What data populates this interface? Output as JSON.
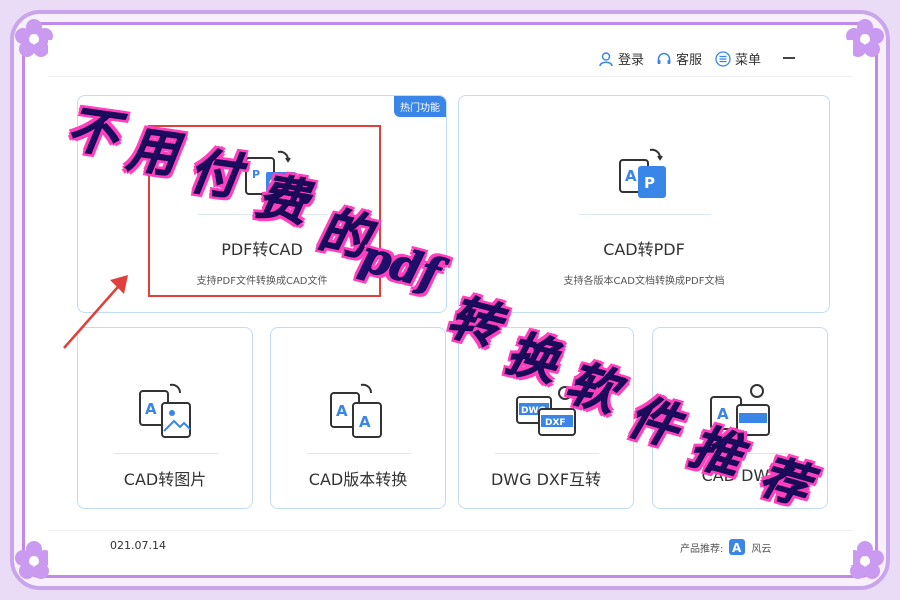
{
  "topbar": {
    "login_label": "登录",
    "service_label": "客服",
    "menu_label": "菜单"
  },
  "cards": {
    "pdf_to_cad": {
      "title": "PDF转CAD",
      "desc": "支持PDF文件转换成CAD文件",
      "badge": "热门功能"
    },
    "cad_to_pdf": {
      "title": "CAD转PDF",
      "desc": "支持各版本CAD文档转换成PDF文档"
    },
    "cad_to_image": {
      "title": "CAD转图片"
    },
    "cad_version": {
      "title": "CAD版本转换"
    },
    "dwg_dxf": {
      "title": "DWG DXF互转"
    },
    "cad_dwf": {
      "title": "CAD DWF"
    }
  },
  "footer": {
    "date": "021.07.14",
    "recommend_label": "产品推荐:",
    "product_name": "风云"
  },
  "overlay": {
    "title_chars": [
      "不",
      "用",
      "付",
      "费",
      "的",
      "pdf",
      "转",
      "换",
      "软",
      "件",
      "推",
      "荐"
    ]
  },
  "colors": {
    "accent_blue": "#3a86e8",
    "card_border": "#c3dcf5",
    "frame_purple": "#c08be8",
    "overlay_pink": "#ff3fbf",
    "overlay_navy": "#1d0f6b",
    "highlight_red": "#e0403c"
  }
}
